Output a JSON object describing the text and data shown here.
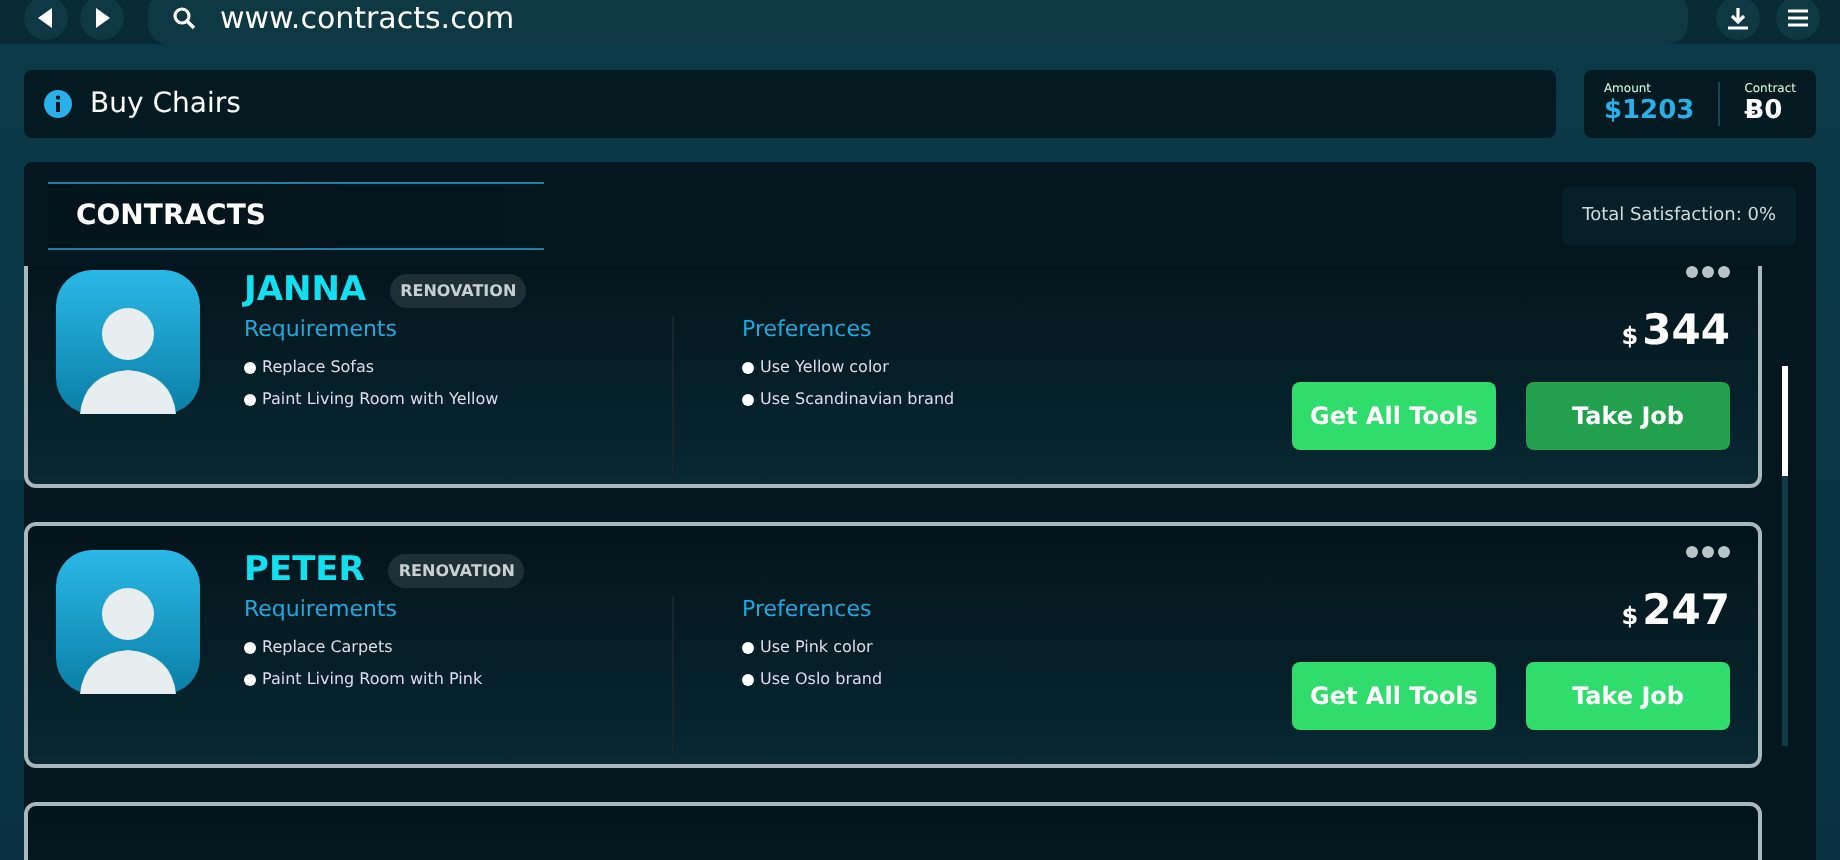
{
  "browser": {
    "url": "www.contracts.com"
  },
  "task": {
    "title": "Buy Chairs"
  },
  "stats": [
    {
      "label": "Amount",
      "value": "$1203",
      "kind": "money"
    },
    {
      "label": "Contract",
      "value": "Ƀ0",
      "kind": "plain"
    }
  ],
  "panel": {
    "title": "CONTRACTS",
    "satisfaction": "Total Satisfaction: 0%"
  },
  "contracts": [
    {
      "name": "JANNA",
      "tag": "RENOVATION",
      "requirements_title": "Requirements",
      "requirements": [
        "Replace Sofas",
        "Paint Living Room with Yellow"
      ],
      "preferences_title": "Preferences",
      "preferences": [
        "Use Yellow color",
        "Use Scandinavian brand"
      ],
      "currency": "$",
      "amount": "344",
      "tools_button": "Get All Tools",
      "job_button": {
        "label": "Take Job",
        "selected": true
      }
    },
    {
      "name": "PETER",
      "tag": "RENOVATION",
      "requirements_title": "Requirements",
      "requirements": [
        "Replace Carpets",
        "Paint Living Room with Pink"
      ],
      "preferences_title": "Preferences",
      "preferences": [
        "Use Pink color",
        "Use Oslo brand"
      ],
      "currency": "$",
      "amount": "247",
      "tools_button": "Get All Tools",
      "job_button": {
        "label": "Take Job",
        "selected": false
      }
    }
  ]
}
